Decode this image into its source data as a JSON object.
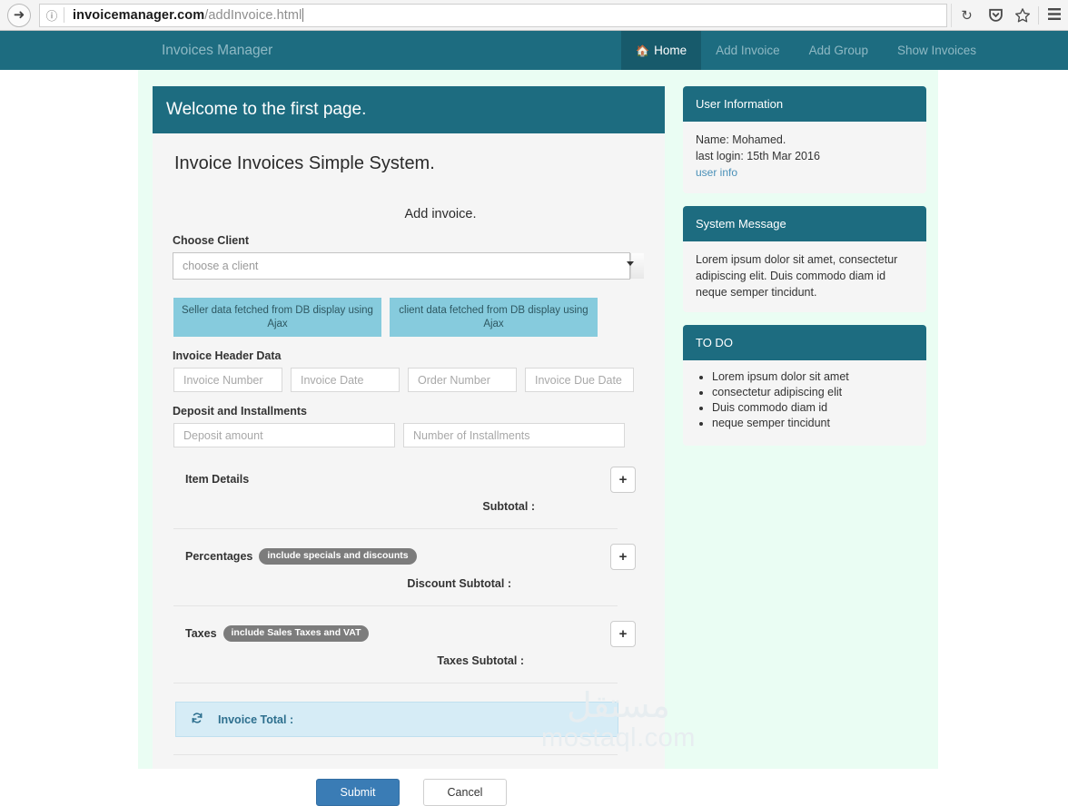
{
  "browser": {
    "back_icon": "back-arrow-icon",
    "info_icon": "info-icon",
    "url_host": "invoicemanager.com",
    "url_path": "/addInvoice.html",
    "reload_icon": "reload-icon",
    "pocket_icon": "pocket-icon",
    "bookmark_icon": "star-icon",
    "menu_icon": "menu-icon"
  },
  "navbar": {
    "brand": "Invoices Manager",
    "items": [
      {
        "label": "Home",
        "icon": "home-icon",
        "active": true
      },
      {
        "label": "Add Invoice",
        "active": false
      },
      {
        "label": "Add Group",
        "active": false
      },
      {
        "label": "Show Invoices",
        "active": false
      }
    ]
  },
  "main": {
    "panel_heading": "Welcome to the first page.",
    "system_title": "Invoice Invoices Simple System.",
    "add_invoice_caption": "Add invoice.",
    "choose_client_label": "Choose Client",
    "client_select_value": "choose a client",
    "ajax_boxes": [
      "Seller data fetched from DB display using Ajax",
      "client data fetched from DB display using Ajax"
    ],
    "invoice_header_label": "Invoice Header Data",
    "header_inputs": [
      "Invoice Number",
      "Invoice Date",
      "Order Number",
      "Invoice Due Date"
    ],
    "deposit_label": "Deposit and Installments",
    "deposit_inputs": [
      "Deposit amount",
      "Number of Installments"
    ],
    "sections": [
      {
        "title": "Item Details",
        "pill": "",
        "add_label": "+",
        "subtotal": "Subtotal :"
      },
      {
        "title": "Percentages",
        "pill": "include specials and discounts",
        "add_label": "+",
        "subtotal": "Discount Subtotal :"
      },
      {
        "title": "Taxes",
        "pill": "include Sales Taxes and VAT",
        "add_label": "+",
        "subtotal": "Taxes Subtotal :"
      }
    ],
    "invoice_total_label": "Invoice Total :",
    "refresh_icon": "refresh-icon",
    "submit_label": "Submit",
    "cancel_label": "Cancel"
  },
  "sidebar": {
    "user_card": {
      "title": "User Information",
      "name": "Name: Mohamed.",
      "last_login": "last login: 15th Mar 2016",
      "link": "user info"
    },
    "system_card": {
      "title": "System Message",
      "text": "Lorem ipsum dolor sit amet, consectetur adipiscing elit. Duis commodo diam id neque semper tincidunt."
    },
    "todo_card": {
      "title": "TO DO",
      "items": [
        "Lorem ipsum dolor sit amet",
        "consectetur adipiscing elit",
        "Duis commodo diam id",
        "neque semper tincidunt"
      ]
    }
  },
  "watermark": {
    "arabic": "مستقل",
    "latin": "mostaql.com"
  },
  "colors": {
    "teal": "#1d6c80",
    "teal_active": "#175a6b",
    "panel_bg": "#f5f5f5",
    "shell_bg": "#eafdf3",
    "ajax_box": "#86cbdd",
    "pill": "#7c7c7c",
    "alert_bg": "#d6ecf6",
    "alert_text": "#2d6f8e",
    "submit": "#3a7cb5"
  }
}
